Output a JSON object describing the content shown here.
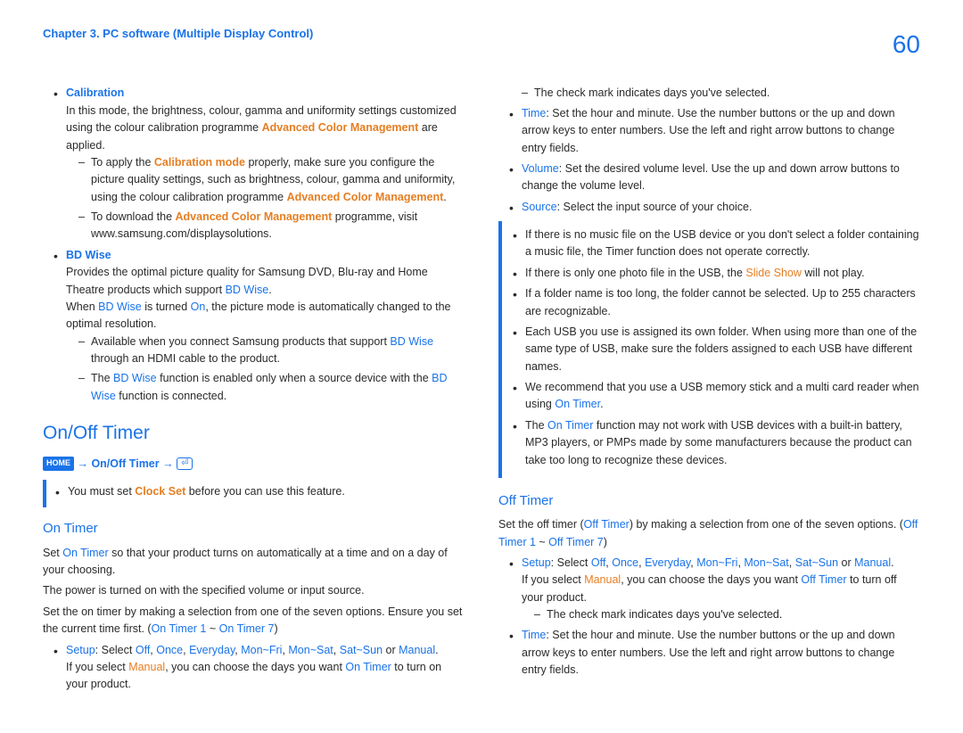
{
  "header": {
    "chapter": "Chapter 3. PC software (Multiple Display Control)",
    "pageNumber": "60"
  },
  "calibration": {
    "title": "Calibration",
    "intro_a": "In this mode, the brightness, colour, gamma and uniformity settings customized using the colour calibration programme ",
    "intro_acm": "Advanced Color Management",
    "intro_b": " are applied.",
    "d1_a": "To apply the ",
    "d1_mode": "Calibration mode",
    "d1_b": " properly, make sure you configure the picture quality settings, such as brightness, colour, gamma and uniformity, using the colour calibration programme ",
    "d1_c": ".",
    "d2_a": "To download the ",
    "d2_b": " programme, visit www.samsung.com/displaysolutions."
  },
  "bdwise": {
    "title": "BD Wise",
    "p1_a": "Provides the optimal picture quality for Samsung DVD, Blu-ray and Home Theatre products which support ",
    "p1_b": ".",
    "p2_a": "When ",
    "p2_b": " is turned ",
    "on": "On",
    "p2_c": ", the picture mode is automatically changed to the optimal resolution.",
    "d1_a": "Available when you connect Samsung products that support ",
    "d1_b": " through an HDMI cable to the product.",
    "d2_a": "The ",
    "d2_b": " function is enabled only when a source device with the ",
    "d2_c": " function is connected."
  },
  "onoff": {
    "title": "On/Off Timer",
    "nav_a": " → ",
    "nav_path": "On/Off Timer",
    "nav_b": " → ",
    "note_a": "You must set ",
    "clockset": "Clock Set",
    "note_b": " before you can use this feature."
  },
  "ontimer": {
    "title": "On Timer",
    "p1_a": "Set ",
    "p1_b": " so that your product turns on automatically at a time and on a day of your choosing.",
    "p2": "The power is turned on with the specified volume or input source.",
    "p3_a": "Set the on timer by making a selection from one of the seven options. Ensure you set the current time first. (",
    "t1": "On Timer 1",
    "tilde": " ~ ",
    "t7": "On Timer 7",
    "p3_b": ")",
    "setup": "Setup",
    "setup_a": ": Select ",
    "off": "Off",
    "once": "Once",
    "everyday": "Everyday",
    "monfri": "Mon~Fri",
    "monsat": "Mon~Sat",
    "satsun": "Sat~Sun",
    "manual": "Manual",
    "comma": ", ",
    "or": " or ",
    "period": ".",
    "setup_b_a": "If you select ",
    "setup_b_b": ", you can choose the days you want ",
    "setup_b_c": " to turn on your product.",
    "check": "The check mark indicates days you've selected.",
    "time": "Time",
    "time_txt": ": Set the hour and minute. Use the number buttons or the up and down arrow keys to enter numbers. Use the left and right arrow buttons to change entry fields.",
    "volume": "Volume",
    "volume_txt": ": Set the desired volume level. Use the up and down arrow buttons to change the volume level.",
    "source": "Source",
    "source_txt": ": Select the input source of your choice."
  },
  "infobox": {
    "i1": "If there is no music file on the USB device or you don't select a folder containing a music file, the Timer function does not operate correctly.",
    "i2_a": "If there is only one photo file in the USB, the ",
    "slideshow": "Slide Show",
    "i2_b": " will not play.",
    "i3": "If a folder name is too long, the folder cannot be selected. Up to 255 characters are recognizable.",
    "i4": "Each USB you use is assigned its own folder. When using more than one of the same type of USB, make sure the folders assigned to each USB have different names.",
    "i5_a": "We recommend that you use a USB memory stick and a multi card reader when using ",
    "i5_b": ".",
    "i6_a": "The ",
    "i6_b": " function may not work with USB devices with a built-in battery, MP3 players, or PMPs made by some manufacturers because the product can take too long to recognize these devices."
  },
  "offtimer": {
    "title": "Off Timer",
    "p1_a": "Set the off timer (",
    "off_t": "Off Timer",
    "p1_b": ") by making a selection from one of the seven options. (",
    "t1": "Off Timer 1",
    "t7": "Off Timer 7",
    "p1_c": ")",
    "setup_b_c": " to turn off your product."
  }
}
